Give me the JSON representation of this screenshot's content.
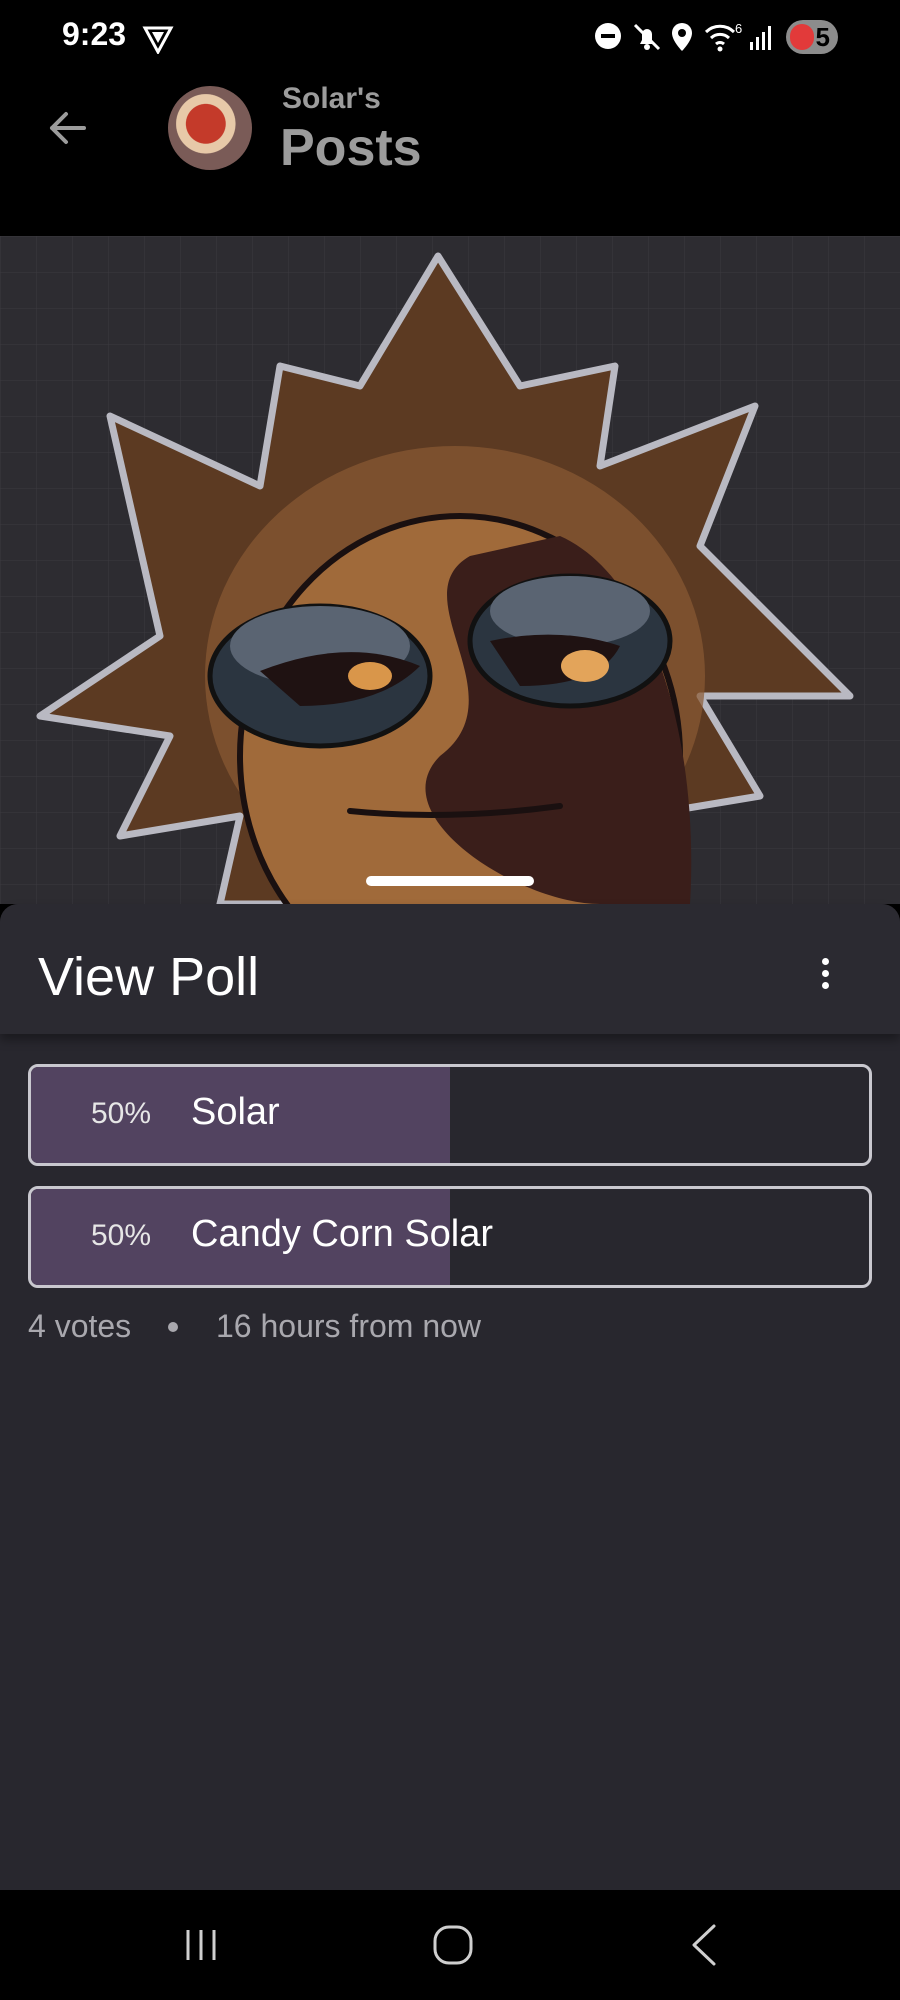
{
  "status_bar": {
    "time": "9:23",
    "network_type": "6",
    "battery_level": "5",
    "icons": [
      "vpn-icon",
      "dnd-icon",
      "mute-icon",
      "location-icon",
      "wifi-icon",
      "signal-icon",
      "battery-icon"
    ]
  },
  "header": {
    "subtitle": "Solar's",
    "title": "Posts",
    "back_icon": "arrow-left-icon"
  },
  "poll": {
    "title": "View Poll",
    "options": [
      {
        "percent": "50%",
        "label": "Solar",
        "fraction": 0.5
      },
      {
        "percent": "50%",
        "label": "Candy Corn Solar",
        "fraction": 0.5
      }
    ],
    "votes": "4 votes",
    "separator": "•",
    "time_left": "16 hours from now"
  },
  "colors": {
    "background": "#000000",
    "sheet": "#28272e",
    "option_fill": "#524360",
    "option_border": "#c9c8cf",
    "muted_text": "#a9a8ae",
    "header_text": "#9c9c9c"
  },
  "navigation": {
    "buttons": [
      "recent-apps-icon",
      "home-icon",
      "back-icon"
    ]
  }
}
